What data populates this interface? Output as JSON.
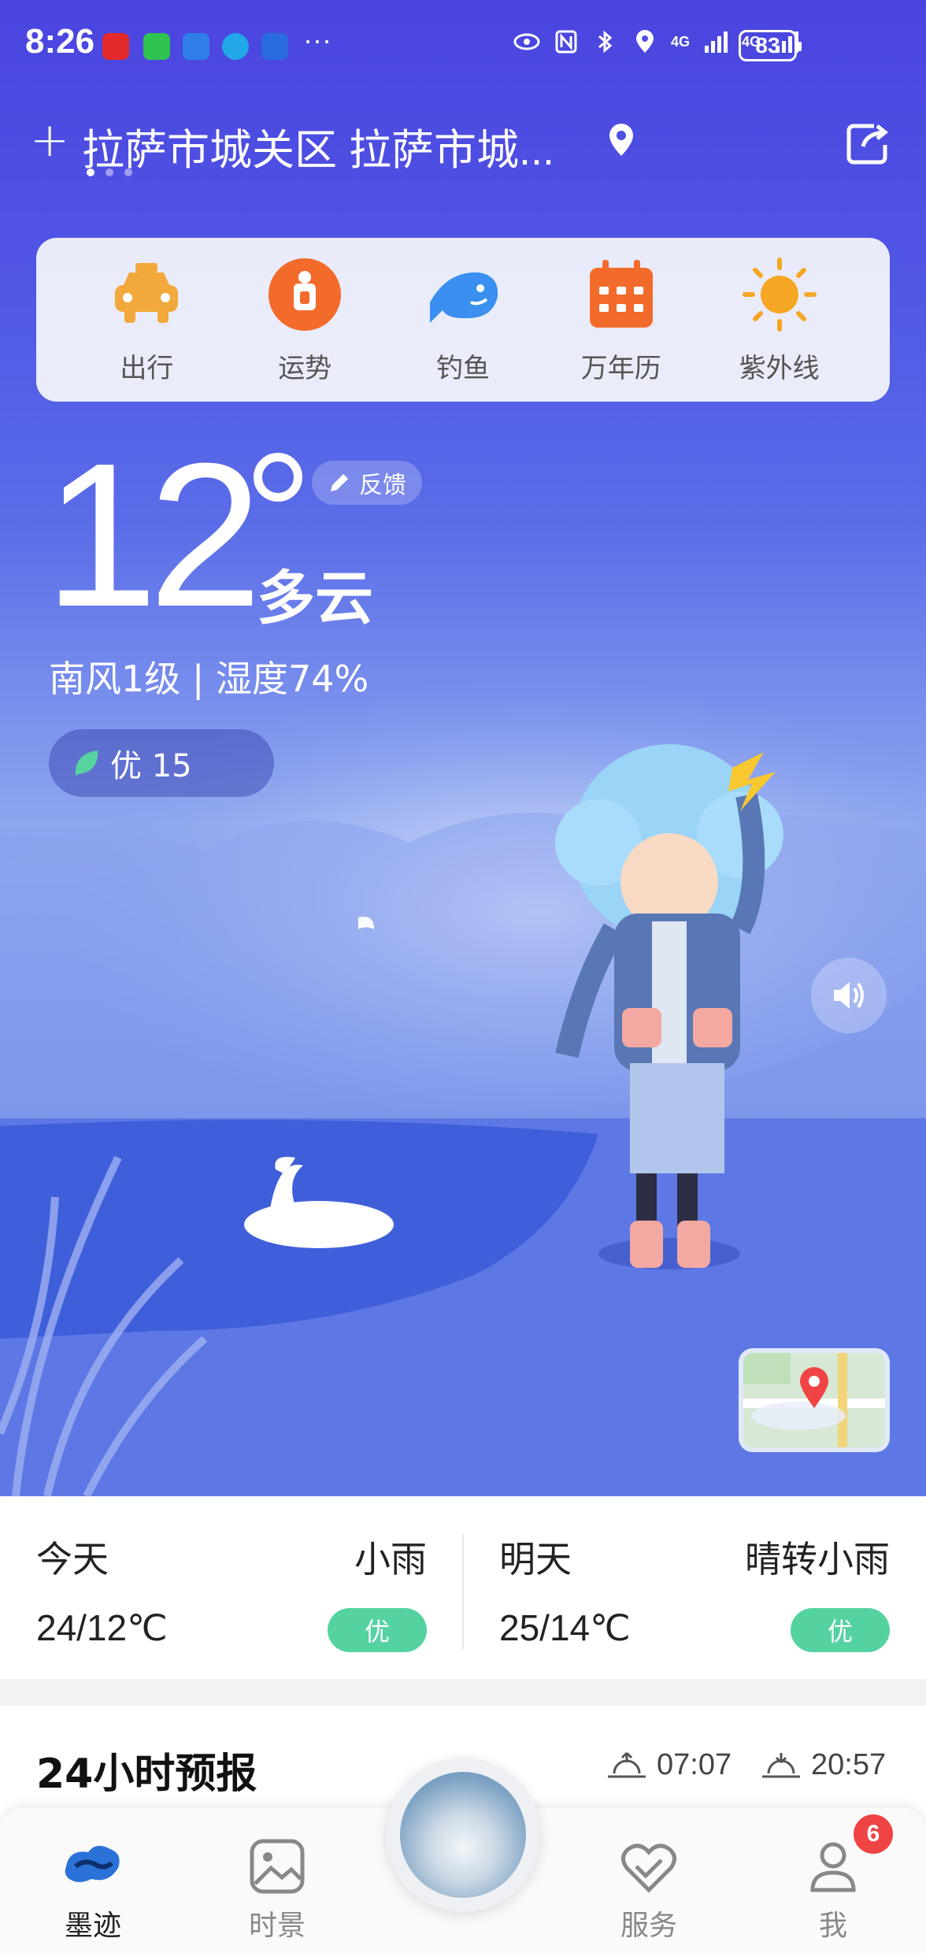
{
  "status_bar": {
    "time": "8:26",
    "app_icons": [
      "byd-icon",
      "wechat-icon",
      "calendar-icon",
      "browser-icon",
      "12123-icon"
    ],
    "more": "···",
    "battery": "83",
    "network": [
      "4G",
      "4G"
    ]
  },
  "header": {
    "add_label": "+",
    "location": "拉萨市城关区 拉萨市城...",
    "page_count": 3,
    "active_page": 0
  },
  "quick_actions": [
    {
      "label": "出行",
      "icon": "taxi-icon",
      "color": "#f2a93b"
    },
    {
      "label": "运势",
      "icon": "fortune-icon",
      "color": "#f26b2b"
    },
    {
      "label": "钓鱼",
      "icon": "fish-icon",
      "color": "#3a8ff0"
    },
    {
      "label": "万年历",
      "icon": "calendar-icon",
      "color": "#f26b2b"
    },
    {
      "label": "紫外线",
      "icon": "sun-icon",
      "color": "#f5a623"
    }
  ],
  "current": {
    "temperature": "12",
    "condition": "多云",
    "feedback_label": "反馈",
    "wind_humidity": "南风1级 | 湿度74%",
    "aqi_label": "优 15"
  },
  "forecast": [
    {
      "day": "今天",
      "condition": "小雨",
      "temp": "24/12℃",
      "aqi": "优"
    },
    {
      "day": "明天",
      "condition": "晴转小雨",
      "temp": "25/14℃",
      "aqi": "优"
    }
  ],
  "hourly": {
    "title": "24小时预报",
    "sunrise": "07:07",
    "sunset": "20:57"
  },
  "tabs": [
    {
      "label": "墨迹",
      "icon": "moji-logo-icon",
      "active": true
    },
    {
      "label": "时景",
      "icon": "gallery-icon",
      "active": false
    },
    {
      "label": "服务",
      "icon": "service-icon",
      "active": false
    },
    {
      "label": "我",
      "icon": "profile-icon",
      "active": false
    }
  ],
  "notifications": {
    "count": "6"
  },
  "colors": {
    "accent": "#4a44df",
    "aqi_good": "#54d3a1",
    "badge": "#f04444"
  }
}
